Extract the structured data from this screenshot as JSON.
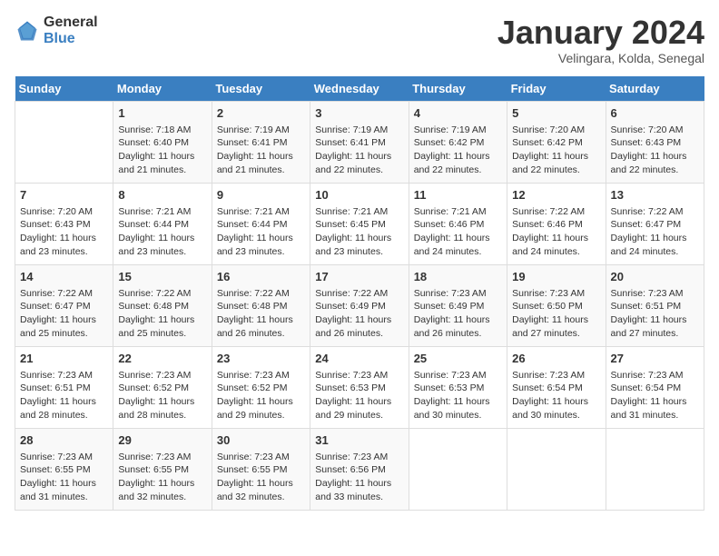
{
  "header": {
    "logo_general": "General",
    "logo_blue": "Blue",
    "month_title": "January 2024",
    "location": "Velingara, Kolda, Senegal"
  },
  "days_of_week": [
    "Sunday",
    "Monday",
    "Tuesday",
    "Wednesday",
    "Thursday",
    "Friday",
    "Saturday"
  ],
  "weeks": [
    [
      {
        "day": "",
        "sunrise": "",
        "sunset": "",
        "daylight": ""
      },
      {
        "day": "1",
        "sunrise": "Sunrise: 7:18 AM",
        "sunset": "Sunset: 6:40 PM",
        "daylight": "Daylight: 11 hours and 21 minutes."
      },
      {
        "day": "2",
        "sunrise": "Sunrise: 7:19 AM",
        "sunset": "Sunset: 6:41 PM",
        "daylight": "Daylight: 11 hours and 21 minutes."
      },
      {
        "day": "3",
        "sunrise": "Sunrise: 7:19 AM",
        "sunset": "Sunset: 6:41 PM",
        "daylight": "Daylight: 11 hours and 22 minutes."
      },
      {
        "day": "4",
        "sunrise": "Sunrise: 7:19 AM",
        "sunset": "Sunset: 6:42 PM",
        "daylight": "Daylight: 11 hours and 22 minutes."
      },
      {
        "day": "5",
        "sunrise": "Sunrise: 7:20 AM",
        "sunset": "Sunset: 6:42 PM",
        "daylight": "Daylight: 11 hours and 22 minutes."
      },
      {
        "day": "6",
        "sunrise": "Sunrise: 7:20 AM",
        "sunset": "Sunset: 6:43 PM",
        "daylight": "Daylight: 11 hours and 22 minutes."
      }
    ],
    [
      {
        "day": "7",
        "sunrise": "Sunrise: 7:20 AM",
        "sunset": "Sunset: 6:43 PM",
        "daylight": "Daylight: 11 hours and 23 minutes."
      },
      {
        "day": "8",
        "sunrise": "Sunrise: 7:21 AM",
        "sunset": "Sunset: 6:44 PM",
        "daylight": "Daylight: 11 hours and 23 minutes."
      },
      {
        "day": "9",
        "sunrise": "Sunrise: 7:21 AM",
        "sunset": "Sunset: 6:44 PM",
        "daylight": "Daylight: 11 hours and 23 minutes."
      },
      {
        "day": "10",
        "sunrise": "Sunrise: 7:21 AM",
        "sunset": "Sunset: 6:45 PM",
        "daylight": "Daylight: 11 hours and 23 minutes."
      },
      {
        "day": "11",
        "sunrise": "Sunrise: 7:21 AM",
        "sunset": "Sunset: 6:46 PM",
        "daylight": "Daylight: 11 hours and 24 minutes."
      },
      {
        "day": "12",
        "sunrise": "Sunrise: 7:22 AM",
        "sunset": "Sunset: 6:46 PM",
        "daylight": "Daylight: 11 hours and 24 minutes."
      },
      {
        "day": "13",
        "sunrise": "Sunrise: 7:22 AM",
        "sunset": "Sunset: 6:47 PM",
        "daylight": "Daylight: 11 hours and 24 minutes."
      }
    ],
    [
      {
        "day": "14",
        "sunrise": "Sunrise: 7:22 AM",
        "sunset": "Sunset: 6:47 PM",
        "daylight": "Daylight: 11 hours and 25 minutes."
      },
      {
        "day": "15",
        "sunrise": "Sunrise: 7:22 AM",
        "sunset": "Sunset: 6:48 PM",
        "daylight": "Daylight: 11 hours and 25 minutes."
      },
      {
        "day": "16",
        "sunrise": "Sunrise: 7:22 AM",
        "sunset": "Sunset: 6:48 PM",
        "daylight": "Daylight: 11 hours and 26 minutes."
      },
      {
        "day": "17",
        "sunrise": "Sunrise: 7:22 AM",
        "sunset": "Sunset: 6:49 PM",
        "daylight": "Daylight: 11 hours and 26 minutes."
      },
      {
        "day": "18",
        "sunrise": "Sunrise: 7:23 AM",
        "sunset": "Sunset: 6:49 PM",
        "daylight": "Daylight: 11 hours and 26 minutes."
      },
      {
        "day": "19",
        "sunrise": "Sunrise: 7:23 AM",
        "sunset": "Sunset: 6:50 PM",
        "daylight": "Daylight: 11 hours and 27 minutes."
      },
      {
        "day": "20",
        "sunrise": "Sunrise: 7:23 AM",
        "sunset": "Sunset: 6:51 PM",
        "daylight": "Daylight: 11 hours and 27 minutes."
      }
    ],
    [
      {
        "day": "21",
        "sunrise": "Sunrise: 7:23 AM",
        "sunset": "Sunset: 6:51 PM",
        "daylight": "Daylight: 11 hours and 28 minutes."
      },
      {
        "day": "22",
        "sunrise": "Sunrise: 7:23 AM",
        "sunset": "Sunset: 6:52 PM",
        "daylight": "Daylight: 11 hours and 28 minutes."
      },
      {
        "day": "23",
        "sunrise": "Sunrise: 7:23 AM",
        "sunset": "Sunset: 6:52 PM",
        "daylight": "Daylight: 11 hours and 29 minutes."
      },
      {
        "day": "24",
        "sunrise": "Sunrise: 7:23 AM",
        "sunset": "Sunset: 6:53 PM",
        "daylight": "Daylight: 11 hours and 29 minutes."
      },
      {
        "day": "25",
        "sunrise": "Sunrise: 7:23 AM",
        "sunset": "Sunset: 6:53 PM",
        "daylight": "Daylight: 11 hours and 30 minutes."
      },
      {
        "day": "26",
        "sunrise": "Sunrise: 7:23 AM",
        "sunset": "Sunset: 6:54 PM",
        "daylight": "Daylight: 11 hours and 30 minutes."
      },
      {
        "day": "27",
        "sunrise": "Sunrise: 7:23 AM",
        "sunset": "Sunset: 6:54 PM",
        "daylight": "Daylight: 11 hours and 31 minutes."
      }
    ],
    [
      {
        "day": "28",
        "sunrise": "Sunrise: 7:23 AM",
        "sunset": "Sunset: 6:55 PM",
        "daylight": "Daylight: 11 hours and 31 minutes."
      },
      {
        "day": "29",
        "sunrise": "Sunrise: 7:23 AM",
        "sunset": "Sunset: 6:55 PM",
        "daylight": "Daylight: 11 hours and 32 minutes."
      },
      {
        "day": "30",
        "sunrise": "Sunrise: 7:23 AM",
        "sunset": "Sunset: 6:55 PM",
        "daylight": "Daylight: 11 hours and 32 minutes."
      },
      {
        "day": "31",
        "sunrise": "Sunrise: 7:23 AM",
        "sunset": "Sunset: 6:56 PM",
        "daylight": "Daylight: 11 hours and 33 minutes."
      },
      {
        "day": "",
        "sunrise": "",
        "sunset": "",
        "daylight": ""
      },
      {
        "day": "",
        "sunrise": "",
        "sunset": "",
        "daylight": ""
      },
      {
        "day": "",
        "sunrise": "",
        "sunset": "",
        "daylight": ""
      }
    ]
  ]
}
